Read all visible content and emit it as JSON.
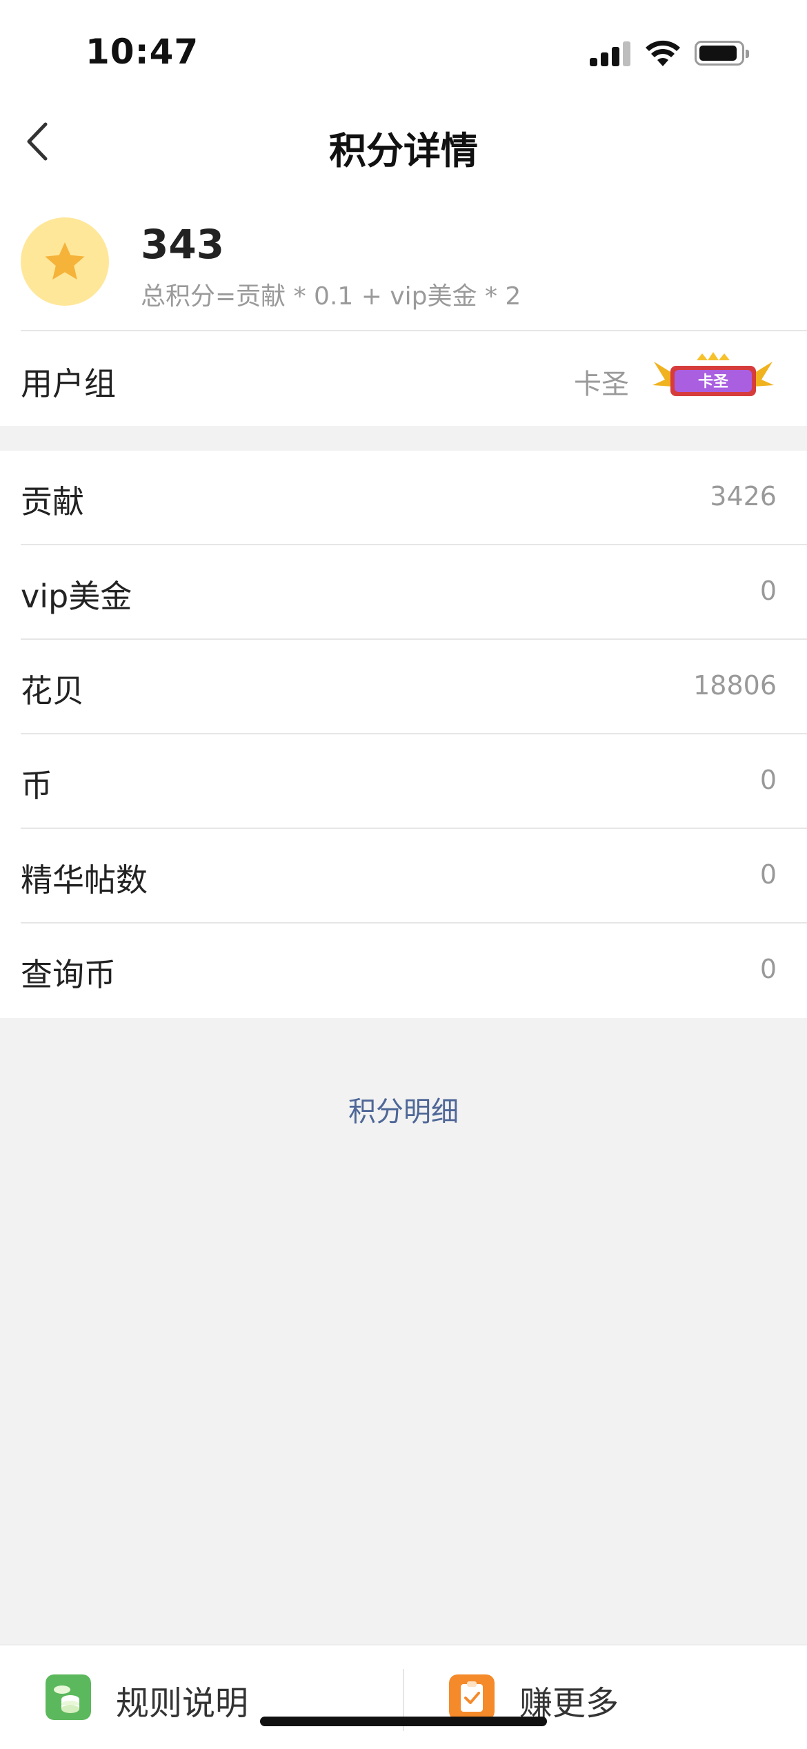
{
  "status_bar": {
    "time": "10:47"
  },
  "nav": {
    "title": "积分详情"
  },
  "summary": {
    "total": "343",
    "formula": "总积分=贡献 * 0.1 + vip美金 * 2"
  },
  "user_group": {
    "label": "用户组",
    "value": "卡圣",
    "badge_text": "卡圣"
  },
  "stats": [
    {
      "label": "贡献",
      "value": "3426"
    },
    {
      "label": "vip美金",
      "value": "0"
    },
    {
      "label": "花贝",
      "value": "18806"
    },
    {
      "label": "币",
      "value": "0"
    },
    {
      "label": "精华帖数",
      "value": "0"
    },
    {
      "label": "查询币",
      "value": "0"
    }
  ],
  "detail_link": "积分明细",
  "bottom_tabs": [
    {
      "label": "规则说明",
      "icon": "coins-icon",
      "color": "#5cb85c"
    },
    {
      "label": "赚更多",
      "icon": "clipboard-check-icon",
      "color": "#f58a2a"
    }
  ],
  "colors": {
    "accent_star": "#f5b33a",
    "avatar_bg": "#ffe79a",
    "link": "#4f6797"
  }
}
